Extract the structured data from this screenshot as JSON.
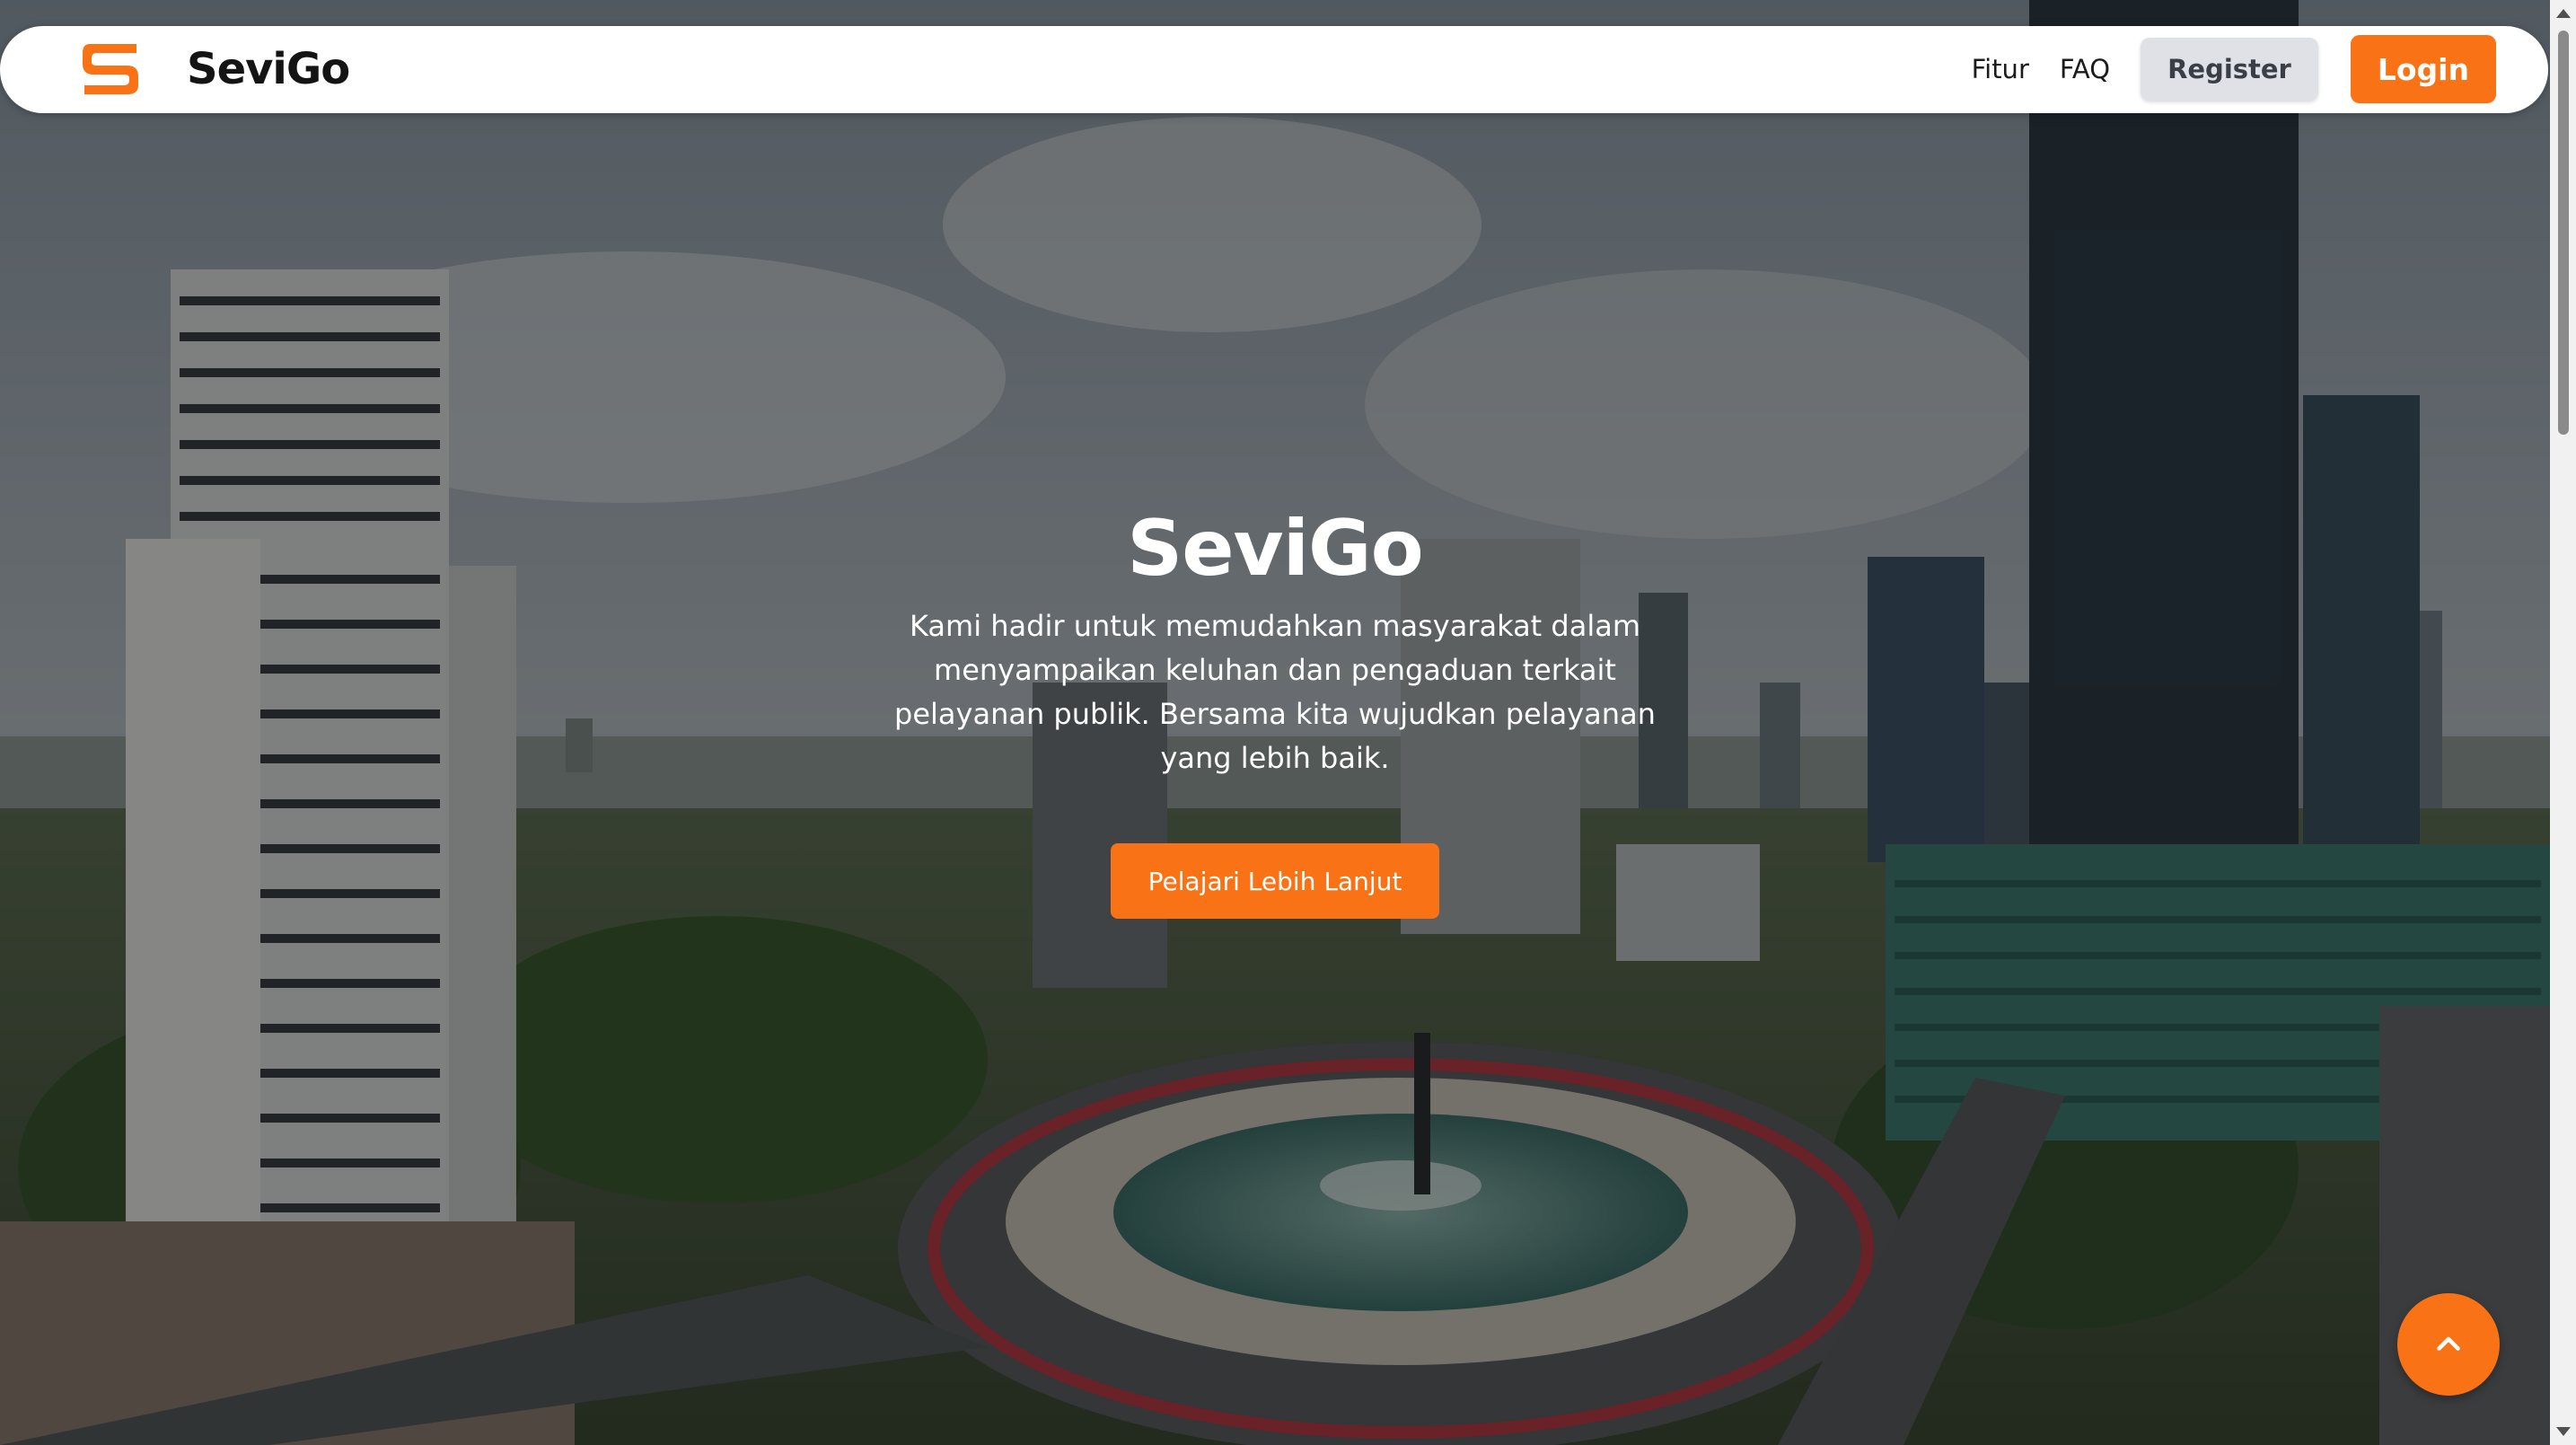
{
  "navbar": {
    "brand_name": "SeviGo",
    "logo_icon": "sevigo-s-logo-icon",
    "links": {
      "fitur": "Fitur",
      "faq": "FAQ"
    },
    "register_label": "Register",
    "login_label": "Login"
  },
  "hero": {
    "title": "SeviGo",
    "description": "Kami hadir untuk memudahkan masyarakat dalam menyampaikan keluhan dan pengaduan terkait pelayanan publik. Bersama kita wujudkan pelayanan yang lebih baik.",
    "cta_label": "Pelajari Lebih Lanjut",
    "background": "city-skyline-roundabout-photo"
  },
  "back_to_top": {
    "icon": "chevron-up-icon"
  },
  "colors": {
    "accent": "#f97316",
    "register_bg": "#dfe1e6",
    "navbar_bg": "#ffffff",
    "text_dark": "#141414"
  }
}
